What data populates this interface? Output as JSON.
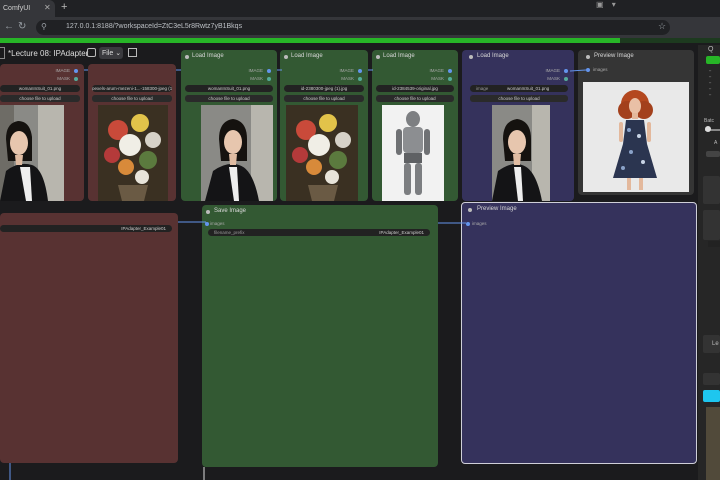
{
  "browser": {
    "tab_title": "ComfyUI",
    "new_tab": "+",
    "url": "127.0.0.1:8188/?workspaceId=ZtC3eL5r8Rwtz7yB1Bkqs"
  },
  "menu": {
    "workflow_name": "*Lecture 08: IPAdapter",
    "file_label": "File"
  },
  "nodes": {
    "load1": {
      "image_out": "IMAGE",
      "mask_out": "MASK",
      "filename": "womanInSuit_01.png",
      "upload": "choose file to upload"
    },
    "load2": {
      "filename": "pexels-arum-mezeni-1...-158300-jpeg (1).jpg",
      "upload": "choose file to upload"
    },
    "load3": {
      "title": "Load Image",
      "image_out": "IMAGE",
      "mask_out": "MASK",
      "filename": "womanInSuit_01.png",
      "upload": "choose file to upload"
    },
    "load4": {
      "title": "Load Image",
      "image_out": "IMAGE",
      "mask_out": "MASK",
      "filename": "id-2380300-jpeg (1).jpg",
      "upload": "choose file to upload"
    },
    "load5": {
      "title": "Load Image",
      "image_out": "IMAGE",
      "mask_out": "MASK",
      "filename": "id-2384539-original.jpg",
      "upload": "choose file to upload"
    },
    "load6": {
      "title": "Load Image",
      "image_out": "IMAGE",
      "mask_out": "MASK",
      "image_label": "image",
      "filename": "womanInSuit_01.png",
      "upload": "choose file to upload"
    },
    "preview_top": {
      "title": "Preview Image",
      "images_in": "images"
    },
    "red_bottom": {
      "filename_prefix": "IPAdapter_Example01"
    },
    "save_image": {
      "title": "Save Image",
      "images_in": "images",
      "prefix_label": "filename_prefix",
      "prefix_value": "IPAdapter_Example01"
    },
    "preview_bottom": {
      "title": "Preview Image",
      "images_in": "images"
    }
  },
  "right_panel": {
    "title_fragment": "Q",
    "batch_label": "Batc",
    "letter_a": "A",
    "letter_le": "Le"
  },
  "colors": {
    "accent_green": "#27b527",
    "node_red": "#583232",
    "node_green": "#335933",
    "node_purple": "#35325c"
  },
  "icons": [
    "lock-icon",
    "star-icon",
    "file-icon",
    "save-icon",
    "chevron-down-icon"
  ]
}
